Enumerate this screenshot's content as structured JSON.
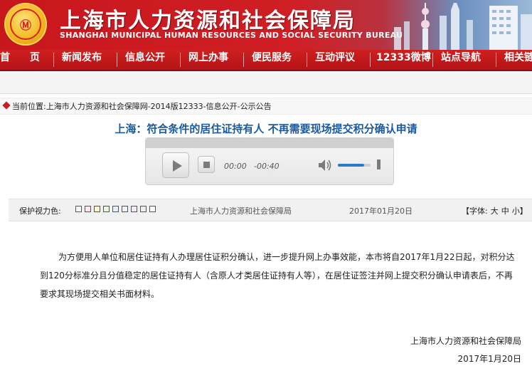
{
  "header": {
    "title": "上海市人力资源和社会保障局",
    "subtitle": "SHANGHAI MUNICIPAL HUMAN RESOURCES AND SOCIAL SECURITY BUREAU"
  },
  "nav": {
    "items": [
      "首　　页",
      "新闻发布",
      "信息公开",
      "网上办事",
      "便民服务",
      "互动评议",
      "12333微博",
      "站点导航",
      "相关链接"
    ]
  },
  "breadcrumb": {
    "text": "当前位置:上海市人力资源和社会保障网-2014版12333-信息公开-公示公告"
  },
  "article": {
    "title": "上海：符合条件的居住证持有人 不再需要现场提交积分确认申请",
    "body": "为方便用人单位和居住证持有人办理居住证积分确认，进一步提升网上办事效能，本市将自2017年1月22日起，对积分达到120分标准分且分值稳定的居住证持有人（含原人才类居住证持有人等），在居住证签注并网上提交积分确认申请表后，不再要求其现场提交相关书面材料。",
    "signature_org": "上海市人力资源和社会保障局",
    "signature_date": "2017年1月20日"
  },
  "player": {
    "current_time": "00:00",
    "remaining_time": "-00:40",
    "volume": 0.8
  },
  "toolbar": {
    "eye_label": "保护视力色:",
    "swatch_colors": [
      "#fafafa",
      "#fbe7ee",
      "#fef3c8",
      "#e8f6e0",
      "#e3f0fb",
      "#eef0f7",
      "#f2e8f7",
      "#eeeeee",
      "#ffffff"
    ],
    "org": "上海市人力资源和社会保障局",
    "date": "2017年01月20日",
    "font_label": "【字体:",
    "font_large": "大",
    "font_medium": "中",
    "font_small": "小",
    "font_close": "】"
  },
  "colors": {
    "brand_red": "#c81d22",
    "title_blue": "#1a5a9e",
    "volume_blue": "#2a7ac8"
  }
}
